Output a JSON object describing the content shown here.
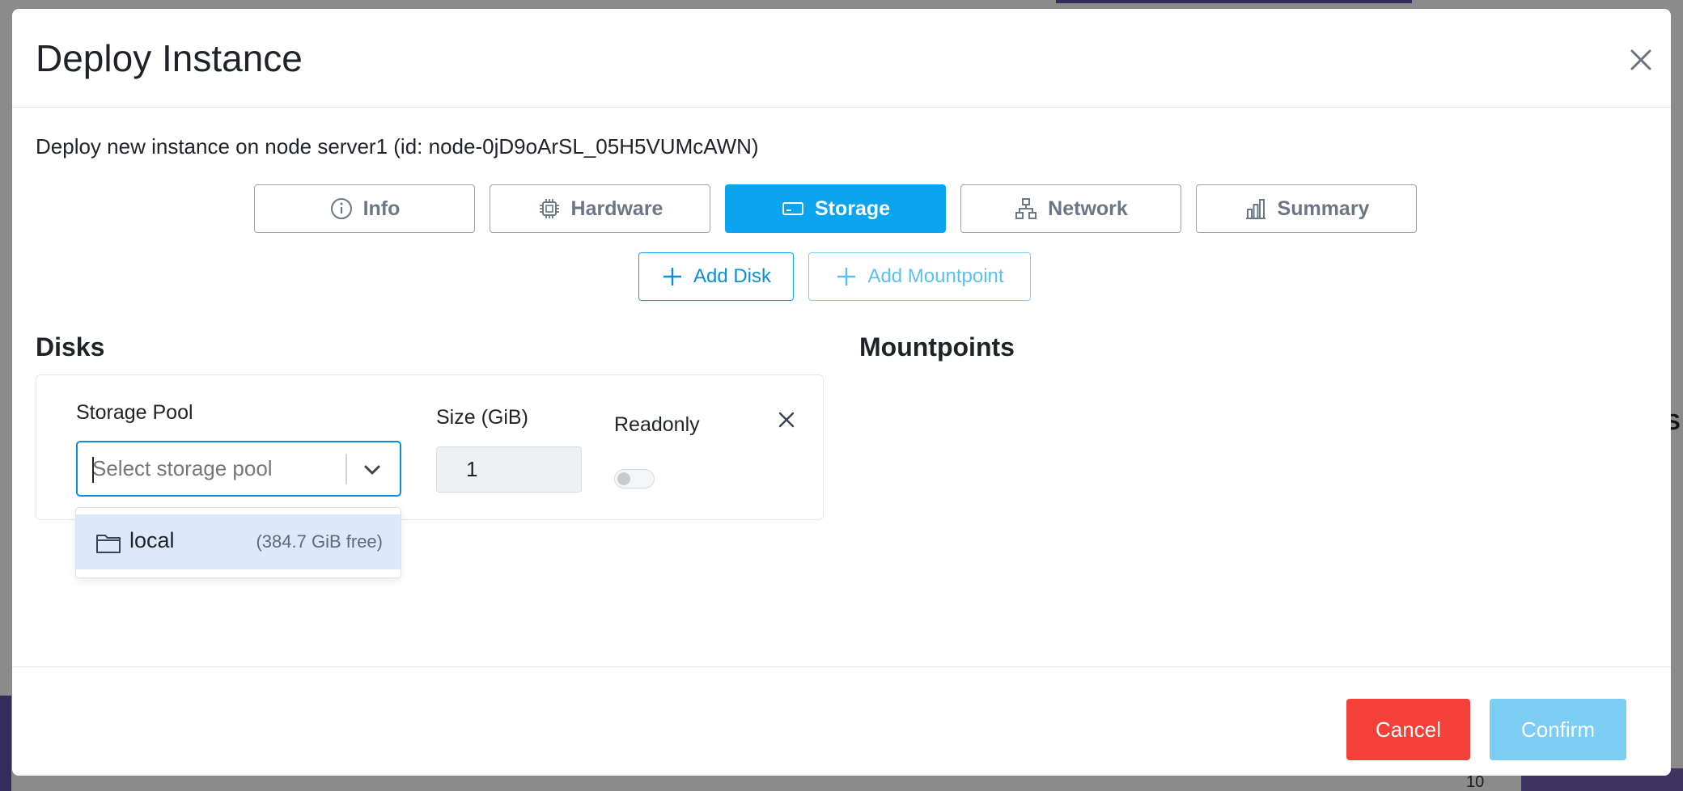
{
  "background": {
    "axis_tick": "10",
    "edge_fragment": "S"
  },
  "modal": {
    "title": "Deploy Instance",
    "subtitle": "Deploy new instance on node server1 (id: node-0jD9oArSL_05H5VUMcAWN)"
  },
  "tabs": [
    {
      "label": "Info",
      "icon": "info-icon",
      "active": false
    },
    {
      "label": "Hardware",
      "icon": "cpu-icon",
      "active": false
    },
    {
      "label": "Storage",
      "icon": "drive-icon",
      "active": true
    },
    {
      "label": "Network",
      "icon": "network-icon",
      "active": false
    },
    {
      "label": "Summary",
      "icon": "bar-chart-icon",
      "active": false
    }
  ],
  "actions": {
    "add_disk": "Add Disk",
    "add_mountpoint": "Add Mountpoint"
  },
  "sections": {
    "disks": "Disks",
    "mountpoints": "Mountpoints"
  },
  "disk": {
    "storage_pool_label": "Storage Pool",
    "storage_pool_placeholder": "Select storage pool",
    "storage_pool_value": "",
    "size_label": "Size (GiB)",
    "size_value": "1",
    "readonly_label": "Readonly",
    "readonly": false
  },
  "dropdown": {
    "options": [
      {
        "label": "local",
        "meta": "(384.7 GiB free)",
        "icon": "folder-icon",
        "highlighted": true
      }
    ]
  },
  "footer": {
    "cancel": "Cancel",
    "confirm": "Confirm"
  },
  "colors": {
    "primary": "#0aa5ee",
    "danger": "#f3413a",
    "confirm_disabled": "#7ccdf4"
  }
}
